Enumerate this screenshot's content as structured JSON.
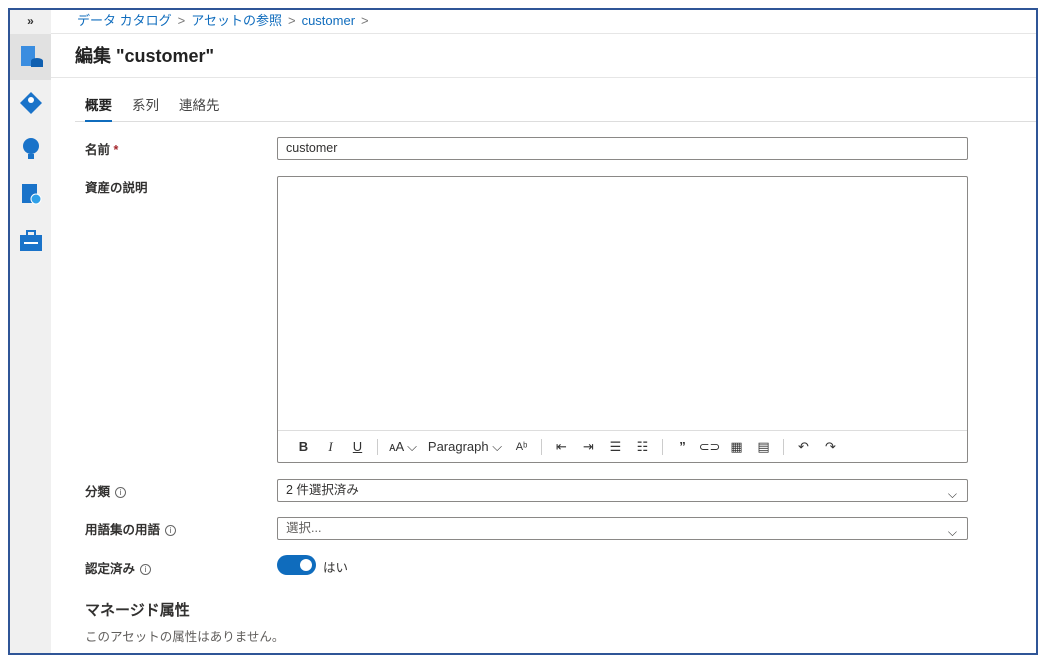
{
  "breadcrumb": [
    "データ カタログ",
    "アセットの参照",
    "customer"
  ],
  "title": "編集 \"customer\"",
  "tabs": [
    "概要",
    "系列",
    "連絡先"
  ],
  "form": {
    "name_label": "名前",
    "name_required": "*",
    "name_value": "customer",
    "description_label": "資産の説明",
    "classification_label": "分類",
    "classification_value": "2 件選択済み",
    "glossary_label": "用語集の用語",
    "glossary_placeholder": "選択...",
    "certified_label": "認定済み",
    "certified_value": "はい",
    "certified_on": true
  },
  "toolbar": {
    "paragraph": "Paragraph"
  },
  "managed": {
    "title": "マネージド属性",
    "empty": "このアセットの属性はありません。"
  },
  "accent": "#0f6cbd"
}
